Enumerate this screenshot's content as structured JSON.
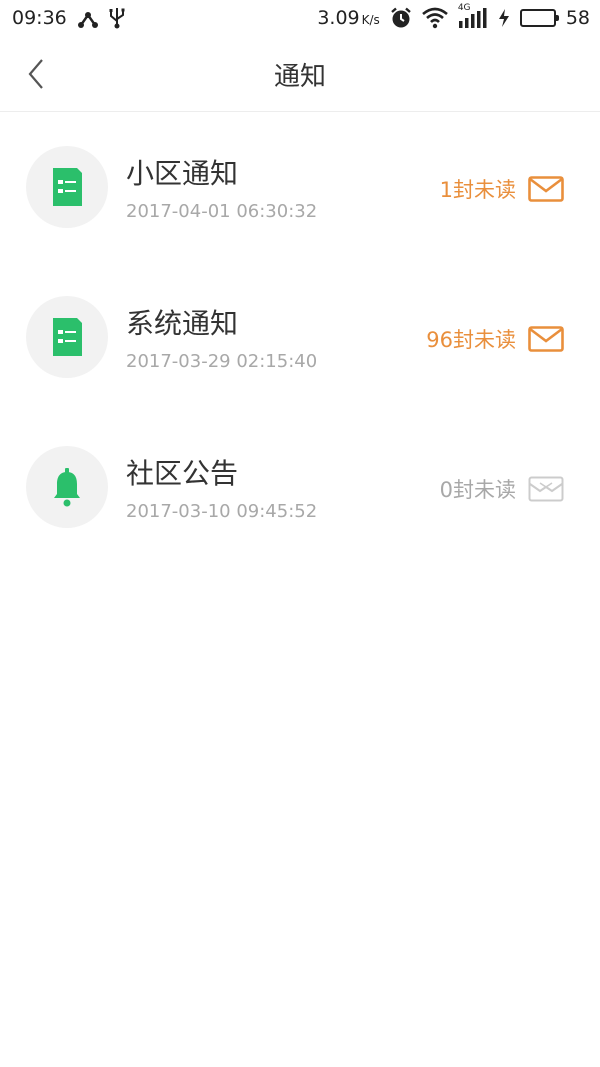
{
  "status_bar": {
    "time": "09:36",
    "speed_value": "3.09",
    "speed_unit": "K/s",
    "network": "4G",
    "battery": "58"
  },
  "nav": {
    "title": "通知"
  },
  "colors": {
    "accent_orange": "#e98f3c",
    "icon_green": "#2bbf6b",
    "muted_gray": "#a8a8a8"
  },
  "notifications": [
    {
      "title": "小区通知",
      "time": "2017-04-01 06:30:32",
      "unread": "1封未读",
      "icon": "document-icon",
      "has_unread": true
    },
    {
      "title": "系统通知",
      "time": "2017-03-29 02:15:40",
      "unread": "96封未读",
      "icon": "document-icon",
      "has_unread": true
    },
    {
      "title": "社区公告",
      "time": "2017-03-10 09:45:52",
      "unread": "0封未读",
      "icon": "bell-icon",
      "has_unread": false
    }
  ]
}
